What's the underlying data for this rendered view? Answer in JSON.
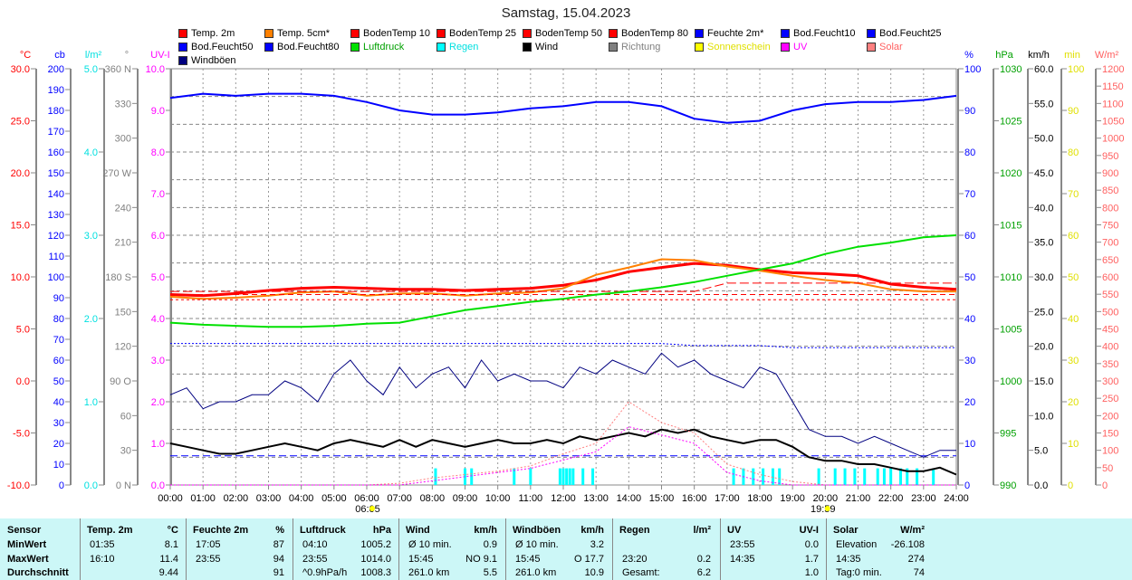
{
  "title": "Samstag, 15.04.2023",
  "legend": [
    {
      "label": "Temp. 2m",
      "color": "#ff0000"
    },
    {
      "label": "Temp. 5cm*",
      "color": "#ff8000"
    },
    {
      "label": "BodenTemp 10",
      "color": "#ff0000"
    },
    {
      "label": "BodenTemp 25",
      "color": "#ff0000"
    },
    {
      "label": "BodenTemp 50",
      "color": "#ff0000"
    },
    {
      "label": "BodenTemp 80",
      "color": "#ff0000"
    },
    {
      "label": "Feuchte 2m*",
      "color": "#0000ff"
    },
    {
      "label": "Bod.Feucht10",
      "color": "#0000ff"
    },
    {
      "label": "Bod.Feucht25",
      "color": "#0000ff"
    },
    {
      "label": "Bod.Feucht50",
      "color": "#0000ff"
    },
    {
      "label": "Bod.Feucht80",
      "color": "#0000ff"
    },
    {
      "label": "Luftdruck",
      "color": "#00e000",
      "text": "#00a000"
    },
    {
      "label": "Regen",
      "color": "#00ffff",
      "text": "#00e0e0"
    },
    {
      "label": "Wind",
      "color": "#000000"
    },
    {
      "label": "Richtung",
      "color": "#808080",
      "text": "#808080"
    },
    {
      "label": "Sonnenschein",
      "color": "#ffff00",
      "text": "#e0e000"
    },
    {
      "label": "UV",
      "color": "#ff00ff",
      "text": "#ff00ff"
    },
    {
      "label": "Solar",
      "color": "#ff8080",
      "text": "#ff6060"
    },
    {
      "label": "Windböen",
      "color": "#000080"
    }
  ],
  "chart_data": {
    "type": "line",
    "title": "Samstag, 15.04.2023",
    "x_ticks": [
      "00:00",
      "01:00",
      "02:00",
      "03:00",
      "04:00",
      "05:00",
      "06:00",
      "07:00",
      "08:00",
      "09:00",
      "10:00",
      "11:00",
      "12:00",
      "13:00",
      "14:00",
      "15:00",
      "16:00",
      "17:00",
      "18:00",
      "19:00",
      "20:00",
      "21:00",
      "22:00",
      "23:00",
      "24:00"
    ],
    "sunrise": "06:05",
    "sunset": "19:59",
    "axes_left": [
      {
        "unit": "°C",
        "color": "#ff0000",
        "min": -10,
        "max": 30,
        "ticks": [
          "30.0",
          "25.0",
          "20.0",
          "15.0",
          "10.0",
          "5.0",
          "0.0",
          "-5.0",
          "-10.0"
        ]
      },
      {
        "unit": "cb",
        "color": "#0000ff",
        "min": 0,
        "max": 200,
        "ticks": [
          "200",
          "190",
          "180",
          "170",
          "160",
          "150",
          "140",
          "130",
          "120",
          "110",
          "100",
          "90",
          "80",
          "70",
          "60",
          "50",
          "40",
          "30",
          "20",
          "10",
          "0"
        ]
      },
      {
        "unit": "l/m²",
        "color": "#00e0e0",
        "min": 0,
        "max": 5,
        "ticks": [
          "5.0",
          "4.0",
          "3.0",
          "2.0",
          "1.0",
          "0.0"
        ]
      },
      {
        "unit": "°",
        "color": "#808080",
        "min": 0,
        "max": 360,
        "ticks": [
          "360 N",
          "330",
          "300",
          "270 W",
          "240",
          "210",
          "180 S",
          "150",
          "120",
          "90 O",
          "60",
          "30",
          "0 N"
        ]
      },
      {
        "unit": "UV-I",
        "color": "#ff00ff",
        "min": 0,
        "max": 10,
        "ticks": [
          "10.0",
          "9.0",
          "8.0",
          "7.0",
          "6.0",
          "5.0",
          "4.0",
          "3.0",
          "2.0",
          "1.0",
          "0.0"
        ]
      }
    ],
    "axes_right": [
      {
        "unit": "%",
        "color": "#0000ff",
        "min": 0,
        "max": 100,
        "ticks": [
          "100",
          "90",
          "80",
          "70",
          "60",
          "50",
          "40",
          "30",
          "20",
          "10",
          "0"
        ]
      },
      {
        "unit": "hPa",
        "color": "#00a000",
        "min": 990,
        "max": 1030,
        "ticks": [
          "1030",
          "1025",
          "1020",
          "1015",
          "1010",
          "1005",
          "1000",
          "995",
          "990"
        ]
      },
      {
        "unit": "km/h",
        "color": "#000000",
        "min": 0,
        "max": 60,
        "ticks": [
          "60.0",
          "55.0",
          "50.0",
          "45.0",
          "40.0",
          "35.0",
          "30.0",
          "25.0",
          "20.0",
          "15.0",
          "10.0",
          "5.0",
          "0.0"
        ]
      },
      {
        "unit": "min",
        "color": "#e0e000",
        "min": 0,
        "max": 100,
        "ticks": [
          "100",
          "90",
          "80",
          "70",
          "60",
          "50",
          "40",
          "30",
          "20",
          "10",
          "0"
        ]
      },
      {
        "unit": "W/m²",
        "color": "#ff6060",
        "min": 0,
        "max": 1200,
        "ticks": [
          "1200",
          "1150",
          "1100",
          "1050",
          "1000",
          "950",
          "900",
          "850",
          "800",
          "750",
          "700",
          "650",
          "600",
          "550",
          "500",
          "450",
          "400",
          "350",
          "300",
          "250",
          "200",
          "150",
          "100",
          "50",
          "0"
        ]
      }
    ],
    "series": [
      {
        "name": "Temp. 2m",
        "axis": "°C",
        "color": "#ff0000",
        "width": 3,
        "step_h": 1,
        "values": [
          8.3,
          8.2,
          8.4,
          8.7,
          8.9,
          9.0,
          8.9,
          8.8,
          8.8,
          8.7,
          8.8,
          8.9,
          9.2,
          9.7,
          10.5,
          10.9,
          11.3,
          11.1,
          10.7,
          10.4,
          10.3,
          10.1,
          9.3,
          9.0,
          8.8
        ]
      },
      {
        "name": "Temp. 5cm*",
        "axis": "°C",
        "color": "#ff8000",
        "width": 2,
        "step_h": 1,
        "values": [
          8.1,
          7.9,
          8.0,
          8.2,
          8.5,
          8.6,
          8.2,
          8.4,
          8.4,
          8.2,
          8.4,
          8.5,
          8.9,
          10.2,
          10.9,
          11.7,
          11.6,
          11.0,
          10.6,
          10.1,
          9.7,
          9.4,
          8.8,
          8.6,
          8.6
        ]
      },
      {
        "name": "BodenTemp 10",
        "axis": "°C",
        "color": "#ff0000",
        "width": 1,
        "dash": "10,4",
        "step_h": 1,
        "values": [
          8.6,
          8.6,
          8.6,
          8.6,
          8.6,
          8.6,
          8.6,
          8.6,
          8.6,
          8.6,
          8.6,
          8.6,
          8.6,
          8.6,
          8.6,
          8.6,
          8.6,
          9.4,
          9.4,
          9.4,
          9.4,
          9.4,
          9.4,
          9.4,
          9.4
        ]
      },
      {
        "name": "BodenTemp 25",
        "axis": "°C",
        "color": "#ff0000",
        "width": 1,
        "dash": "6,4",
        "step_h": 1,
        "values": [
          8.3,
          8.3,
          8.3,
          8.3,
          8.3,
          8.3,
          8.3,
          8.3,
          8.3,
          8.3,
          8.3,
          8.3,
          8.3,
          8.3,
          8.3,
          8.3,
          8.3,
          8.3,
          8.3,
          8.3,
          8.3,
          8.3,
          8.3,
          8.3,
          8.3
        ]
      },
      {
        "name": "BodenTemp 50",
        "axis": "°C",
        "color": "#ff0000",
        "width": 1,
        "dash": "3,3",
        "step_h": 1,
        "values": [
          7.8,
          7.8,
          7.8,
          7.8,
          7.8,
          7.8,
          7.8,
          7.8,
          7.8,
          7.8,
          7.8,
          7.8,
          7.8,
          7.8,
          7.8,
          7.8,
          7.8,
          7.8,
          7.8,
          7.8,
          7.8,
          7.8,
          7.8,
          7.8,
          7.8
        ]
      },
      {
        "name": "Luftdruck",
        "axis": "hPa",
        "color": "#00e000",
        "width": 2,
        "step_h": 1,
        "values": [
          1005.6,
          1005.4,
          1005.3,
          1005.2,
          1005.2,
          1005.3,
          1005.5,
          1005.6,
          1006.2,
          1006.8,
          1007.2,
          1007.6,
          1007.9,
          1008.3,
          1008.6,
          1009.0,
          1009.5,
          1010.1,
          1010.7,
          1011.3,
          1012.2,
          1012.9,
          1013.3,
          1013.8,
          1014.0
        ]
      },
      {
        "name": "Feuchte 2m*",
        "axis": "%",
        "color": "#0000ff",
        "width": 2,
        "step_h": 1,
        "values": [
          93,
          94,
          93.5,
          94,
          94,
          93.5,
          92,
          90,
          89,
          89,
          89.5,
          90.5,
          91,
          92,
          92,
          91,
          88,
          87,
          87.5,
          90,
          91.5,
          92,
          92,
          92.5,
          93.5
        ]
      },
      {
        "name": "Bod.Feucht10",
        "axis": "cb",
        "color": "#0000ff",
        "width": 1,
        "dash": "2,2",
        "step_h": 1,
        "values": [
          68,
          68,
          68,
          68,
          68,
          68,
          68,
          68,
          68,
          68,
          68,
          68,
          68,
          68,
          68,
          68,
          67,
          67,
          67,
          66,
          66,
          66,
          66,
          66,
          66
        ]
      },
      {
        "name": "Bod.Feucht50",
        "axis": "cb",
        "color": "#0000ff",
        "width": 1,
        "dash": "8,4",
        "step_h": 1,
        "values": [
          14,
          14,
          14,
          14,
          14,
          14,
          14,
          14,
          14,
          14,
          14,
          14,
          14,
          14,
          14,
          14,
          14,
          14,
          14,
          14,
          14,
          14,
          14,
          14,
          14
        ]
      },
      {
        "name": "Windböen",
        "axis": "km/h",
        "color": "#000080",
        "width": 1,
        "step_h": 0.5,
        "values": [
          13,
          14,
          11,
          12,
          12,
          13,
          13,
          15,
          14,
          12,
          16,
          18,
          15,
          13,
          17,
          14,
          16,
          17,
          14,
          18,
          15,
          16,
          15,
          15,
          14,
          17,
          16,
          18,
          17,
          16,
          19,
          17,
          18,
          16,
          15,
          14,
          17,
          16,
          12,
          8,
          7,
          7,
          6,
          7,
          6,
          5,
          4,
          5,
          5
        ]
      },
      {
        "name": "Wind",
        "axis": "km/h",
        "color": "#000000",
        "width": 2,
        "step_h": 0.5,
        "values": [
          6,
          5.5,
          5,
          4.5,
          4.5,
          5,
          5.5,
          6,
          5.5,
          5,
          6,
          6.5,
          6,
          5.5,
          6.5,
          5.5,
          6.5,
          6,
          5.5,
          6,
          6.5,
          6,
          6,
          6.5,
          6,
          7,
          6.5,
          7,
          7.5,
          7,
          8,
          7.5,
          8,
          7,
          6.5,
          6,
          6.5,
          6.5,
          5.5,
          4,
          3.5,
          3.5,
          3,
          3,
          2.5,
          2,
          2,
          2.5,
          1.5
        ]
      },
      {
        "name": "Solar",
        "axis": "W/m²",
        "color": "#ff8080",
        "width": 1,
        "dash": "2,2",
        "step_h": 1,
        "values": [
          0,
          0,
          0,
          0,
          0,
          0,
          0,
          5,
          20,
          30,
          40,
          55,
          90,
          120,
          240,
          180,
          150,
          60,
          30,
          10,
          0,
          0,
          0,
          0,
          0
        ]
      },
      {
        "name": "UV",
        "axis": "UV-I",
        "color": "#ff00ff",
        "width": 1,
        "dash": "2,2",
        "step_h": 1,
        "values": [
          0,
          0,
          0,
          0,
          0,
          0,
          0,
          0,
          0.1,
          0.2,
          0.3,
          0.4,
          0.6,
          0.8,
          1.4,
          1.2,
          1.0,
          0.3,
          0.1,
          0,
          0,
          0,
          0,
          0,
          0
        ]
      }
    ],
    "rain": {
      "axis": "l/m²",
      "times": [
        8.1,
        9.0,
        9.2,
        10.5,
        11.0,
        11.9,
        12.0,
        12.1,
        12.2,
        12.3,
        12.6,
        12.9,
        17.2,
        17.5,
        17.8,
        18.1,
        18.4,
        18.6,
        19.8,
        20.3,
        20.6,
        20.9,
        21.2,
        21.6,
        21.8,
        22.0,
        22.3,
        22.5,
        22.8,
        23.3
      ],
      "value": 0.2
    }
  },
  "table": {
    "row_labels": [
      "Sensor",
      "MinWert",
      "MaxWert",
      "Durchschnitt"
    ],
    "columns": [
      {
        "name": "Temp. 2m",
        "unit": "°C",
        "rows": [
          [
            "01:35",
            "8.1"
          ],
          [
            "16:10",
            "11.4"
          ],
          [
            "",
            "9.44"
          ]
        ]
      },
      {
        "name": "Feuchte 2m",
        "unit": "%",
        "rows": [
          [
            "17:05",
            "87"
          ],
          [
            "23:55",
            "94"
          ],
          [
            "",
            "91"
          ]
        ]
      },
      {
        "name": "Luftdruck",
        "unit": "hPa",
        "rows": [
          [
            "04:10",
            "1005.2"
          ],
          [
            "23:55",
            "1014.0"
          ],
          [
            "^0.9hPa/h",
            "1008.3"
          ]
        ]
      },
      {
        "name": "Wind",
        "unit": "km/h",
        "rows": [
          [
            "Ø 10 min.",
            "0.9"
          ],
          [
            "15:45",
            "NO 9.1"
          ],
          [
            "261.0 km",
            "5.5"
          ]
        ]
      },
      {
        "name": "Windböen",
        "unit": "km/h",
        "rows": [
          [
            "Ø 10 min.",
            "3.2"
          ],
          [
            "15:45",
            "O 17.7"
          ],
          [
            "261.0 km",
            "10.9"
          ]
        ]
      },
      {
        "name": "Regen",
        "unit": "l/m²",
        "rows": [
          [
            "",
            ""
          ],
          [
            "23:20",
            "0.2"
          ],
          [
            "Gesamt:",
            "6.2"
          ]
        ]
      },
      {
        "name": "UV",
        "unit": "UV-I",
        "rows": [
          [
            "23:55",
            "0.0"
          ],
          [
            "14:35",
            "1.7"
          ],
          [
            "",
            "1.0"
          ]
        ]
      },
      {
        "name": "Solar",
        "unit": "W/m²",
        "rows": [
          [
            "Elevation",
            "-26.108"
          ],
          [
            "14:35",
            "274"
          ],
          [
            "Tag:0 min.",
            "74"
          ]
        ]
      }
    ]
  }
}
